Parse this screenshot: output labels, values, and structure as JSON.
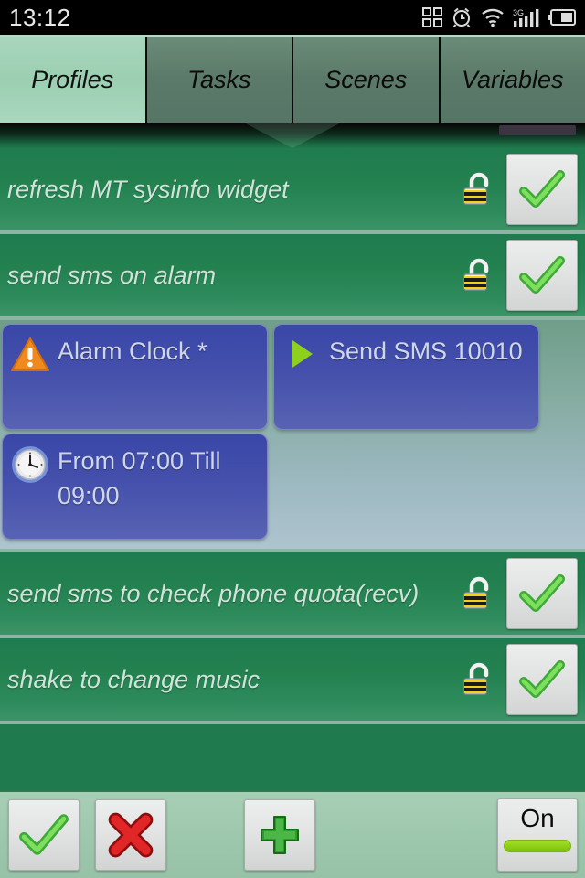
{
  "statusbar": {
    "time": "13:12",
    "icons": [
      "apps-grid-icon",
      "alarm-clock-icon",
      "wifi-icon",
      "signal-3g-icon",
      "battery-icon"
    ],
    "network_label": "3G",
    "background": "#000000"
  },
  "tabs": [
    {
      "label": "Profiles",
      "active": true
    },
    {
      "label": "Tasks",
      "active": false
    },
    {
      "label": "Scenes",
      "active": false
    },
    {
      "label": "Variables",
      "active": false
    }
  ],
  "colors": {
    "accent_green": "#2e8b5c",
    "tab_active": "#a8d6bd",
    "card_blue": "#4450ab",
    "toggle_green": "#8fd117",
    "separator": "#8fb3a4"
  },
  "profiles": [
    {
      "name": "refresh MT sysinfo widget",
      "lock_icon": "unlocked-padlock-icon",
      "enabled_icon": "green-check-icon",
      "expanded": false
    },
    {
      "name": "send sms on alarm",
      "lock_icon": "unlocked-padlock-icon",
      "enabled_icon": "green-check-icon",
      "expanded": true,
      "items": [
        {
          "label": "Alarm Clock *",
          "icon": "warning-triangle-icon"
        },
        {
          "label": "Send SMS 10010",
          "icon": "green-play-icon"
        },
        {
          "label": "From 07:00 Till 09:00",
          "icon": "clock-icon"
        }
      ]
    },
    {
      "name": "send sms to check phone quota(recv)",
      "lock_icon": "unlocked-padlock-icon",
      "enabled_icon": "green-check-icon",
      "expanded": false
    },
    {
      "name": "shake to change music",
      "lock_icon": "unlocked-padlock-icon",
      "enabled_icon": "green-check-icon",
      "expanded": false
    }
  ],
  "bottombar": {
    "accept": "green-check-icon",
    "cancel": "red-x-icon",
    "add": "green-plus-icon",
    "toggle_label": "On",
    "toggle_state": "on"
  }
}
